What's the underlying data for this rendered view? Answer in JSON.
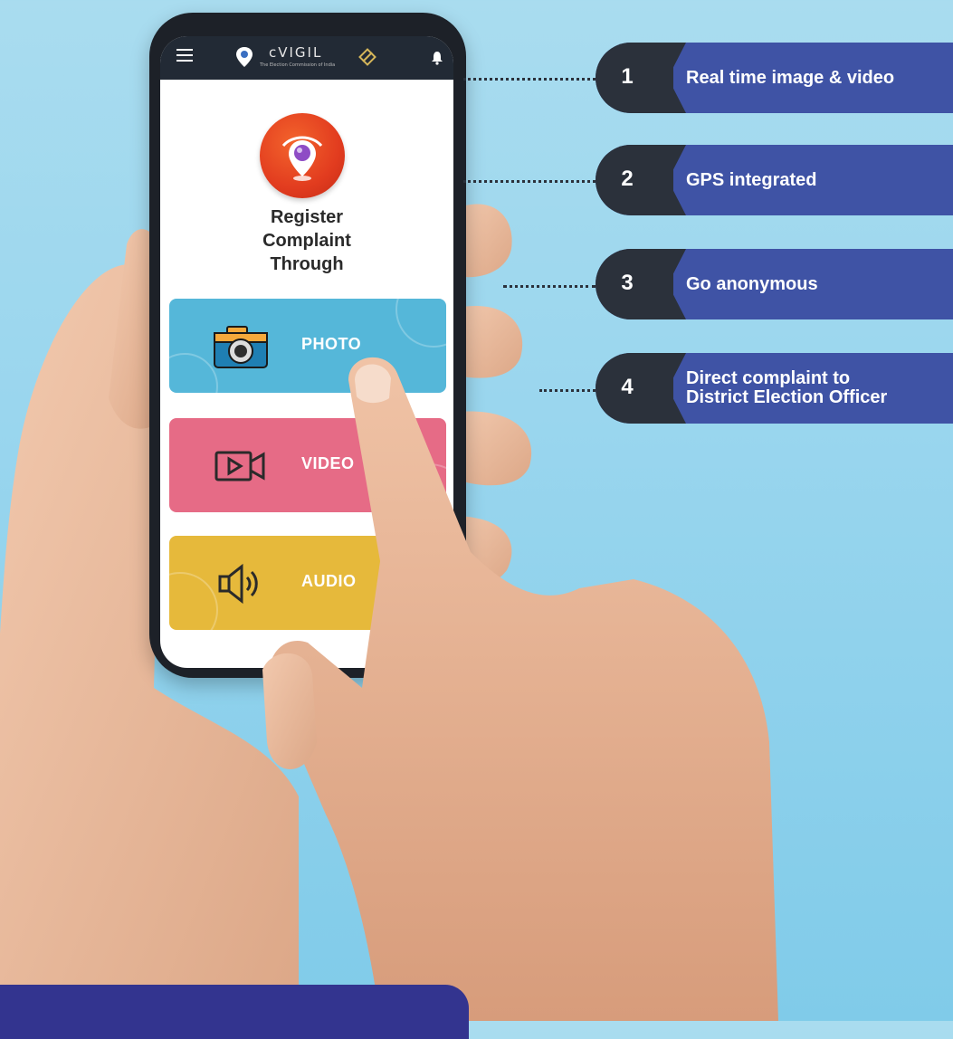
{
  "app": {
    "name": "cVIGIL",
    "tagline": "The Election Commission of India",
    "heading_lines": [
      "Register",
      "Complaint",
      "Through"
    ]
  },
  "options": [
    {
      "label": "PHOTO",
      "icon": "camera-icon",
      "color": "#55b7d9"
    },
    {
      "label": "VIDEO",
      "icon": "video-icon",
      "color": "#e66b86"
    },
    {
      "label": "AUDIO",
      "icon": "speaker-icon",
      "color": "#e6b93b"
    }
  ],
  "features": [
    {
      "num": "1",
      "text": "Real time image & video"
    },
    {
      "num": "2",
      "text": "GPS integrated"
    },
    {
      "num": "3",
      "text": "Go anonymous"
    },
    {
      "num": "4",
      "text": "Direct complaint to District Election Officer"
    }
  ],
  "colors": {
    "background": "#9ad6ee",
    "callout": "#3f53a5",
    "callout_number_box": "#2b313b",
    "banner": "#33348f"
  }
}
